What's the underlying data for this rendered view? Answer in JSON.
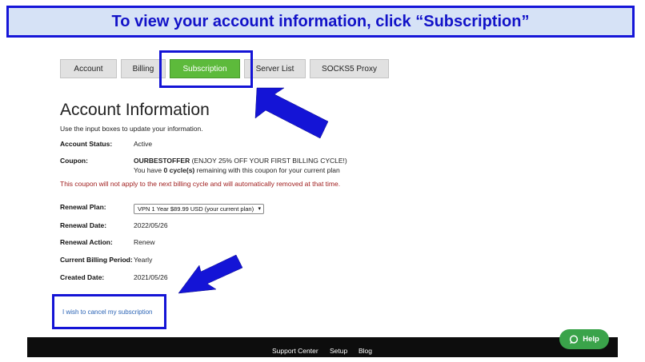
{
  "banner": {
    "text": "To view your account information, click “Subscription”"
  },
  "tabs": [
    {
      "label": "Account"
    },
    {
      "label": "Billing"
    },
    {
      "label": "Subscription"
    },
    {
      "label": "Server List"
    },
    {
      "label": "SOCKS5 Proxy"
    }
  ],
  "page": {
    "title": "Account Information",
    "subtitle": "Use the input boxes to update your information."
  },
  "account_status": {
    "label": "Account Status:",
    "value": "Active"
  },
  "coupon": {
    "label": "Coupon:",
    "code": "OURBESTOFFER",
    "description": "(ENJOY 25% OFF YOUR FIRST BILLING CYCLE!)",
    "remaining_prefix": "You have ",
    "remaining_count": "0 cycle(s)",
    "remaining_suffix": " remaining with this coupon for your current plan"
  },
  "warning": "This coupon will not apply to the next billing cycle and will automatically removed at that time.",
  "renewal_plan": {
    "label": "Renewal Plan:",
    "value": "VPN 1 Year $89.99 USD (your current plan)"
  },
  "renewal_date": {
    "label": "Renewal Date:",
    "value": "2022/05/26"
  },
  "renewal_action": {
    "label": "Renewal Action:",
    "value": "Renew"
  },
  "billing_period": {
    "label": "Current Billing Period:",
    "value": "Yearly"
  },
  "created_date": {
    "label": "Created Date:",
    "value": "2021/05/26"
  },
  "cancel_link": "I wish to cancel my subscription",
  "footer": {
    "links": [
      "Support Center",
      "Setup",
      "Blog"
    ]
  },
  "help_button": {
    "label": "Help",
    "icon": "chat-bubble-icon"
  },
  "colors": {
    "annotation": "#1414d6",
    "active_tab": "#5dba3b",
    "warning": "#a01f1f",
    "link": "#2a63b5",
    "help": "#3aa34a"
  }
}
